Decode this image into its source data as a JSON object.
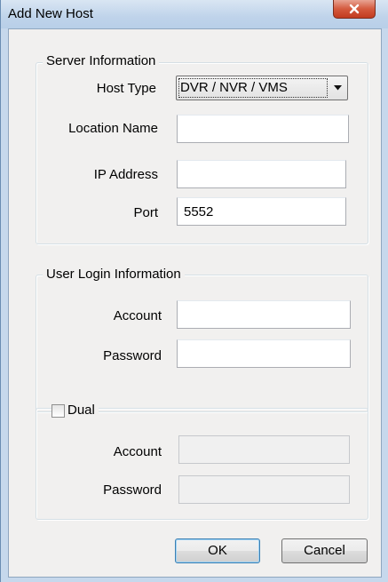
{
  "dialog": {
    "title": "Add New Host"
  },
  "server_info": {
    "legend": "Server Information",
    "host_type_label": "Host Type",
    "host_type_value": "DVR / NVR / VMS",
    "location_label": "Location Name",
    "location_value": "",
    "ip_label": "IP Address",
    "ip_value": "",
    "port_label": "Port",
    "port_value": "5552"
  },
  "user_login": {
    "legend": "User Login Information",
    "account_label": "Account",
    "account_value": "",
    "password_label": "Password",
    "password_value": ""
  },
  "dual": {
    "checkbox_label": "Dual",
    "checked": false,
    "account_label": "Account",
    "account_value": "",
    "password_label": "Password",
    "password_value": ""
  },
  "buttons": {
    "ok": "OK",
    "cancel": "Cancel"
  }
}
